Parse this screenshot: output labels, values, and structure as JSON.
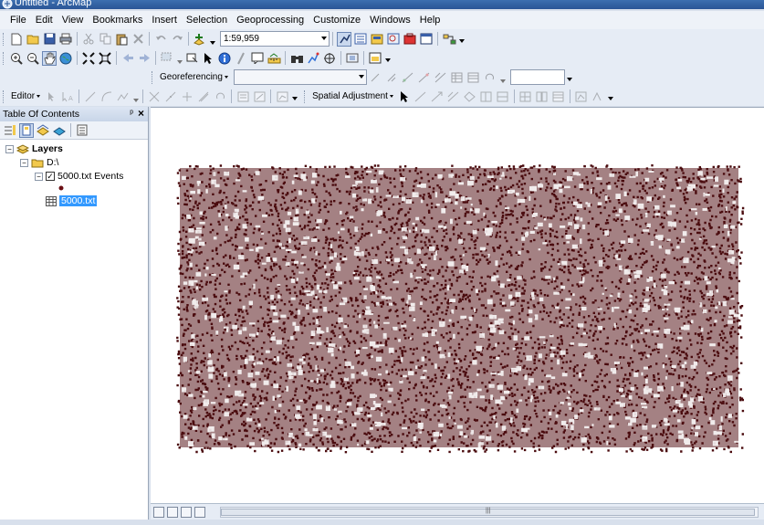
{
  "window": {
    "title": "Untitled - ArcMap"
  },
  "menu": [
    "File",
    "Edit",
    "View",
    "Bookmarks",
    "Insert",
    "Selection",
    "Geoprocessing",
    "Customize",
    "Windows",
    "Help"
  ],
  "standard_toolbar": {
    "scale_value": "1:59,959"
  },
  "georef_toolbar": {
    "label": "Georeferencing"
  },
  "editor_toolbar": {
    "editor_label": "Editor",
    "spatial_adjustment_label": "Spatial Adjustment"
  },
  "toc": {
    "title": "Table Of Contents",
    "pin_glyph": "ᵖ",
    "close_glyph": "×",
    "layers_label": "Layers",
    "folder_label": "D:\\",
    "events_layer_label": "5000.txt Events",
    "table_label": "5000.txt",
    "events_checked": true
  },
  "map": {
    "point_color": "#4a0b0e"
  },
  "colors": {
    "accent": "#3399ff",
    "titlebar": "#2a5596",
    "panel": "#e6ecf5"
  }
}
